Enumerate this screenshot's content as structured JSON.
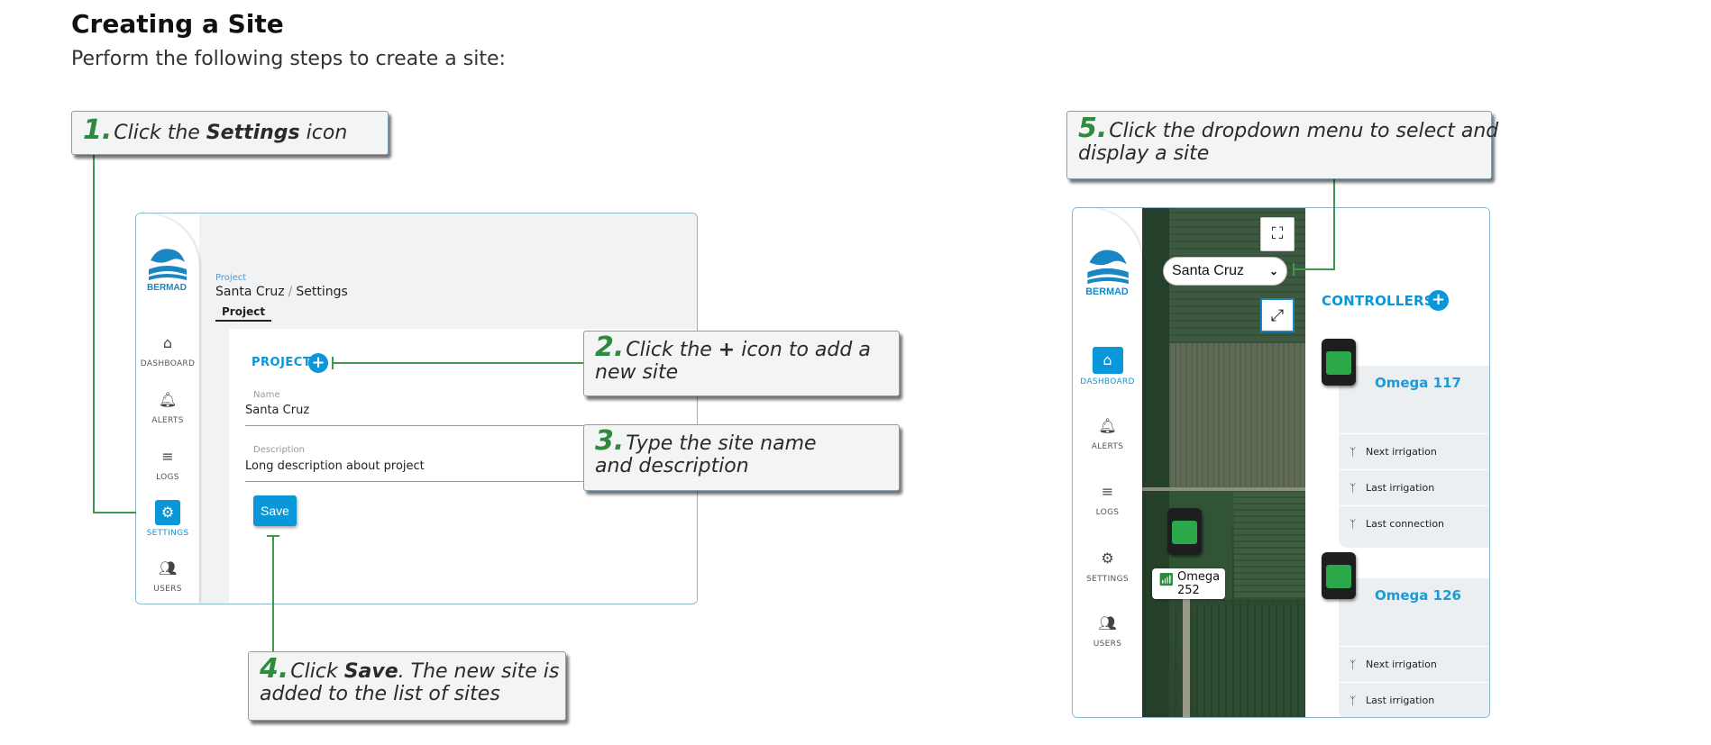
{
  "doc": {
    "title": "Creating a Site",
    "subtitle": "Perform the following steps to create a site:"
  },
  "steps": [
    {
      "num": "1.",
      "pre": "Click the ",
      "bold": "Settings",
      "post": " icon"
    },
    {
      "num": "2.",
      "line1_pre": "Click the ",
      "line1_bold": "+",
      "line1_post": " icon to add a",
      "line2": "new site"
    },
    {
      "num": "3.",
      "line1": "Type the site name",
      "line2": "and description"
    },
    {
      "num": "4.",
      "line1_pre": "Click ",
      "line1_bold": "Save",
      "line1_post": ". The new site is",
      "line2": "added to the list of sites"
    },
    {
      "num": "5.",
      "line1": "Click the dropdown menu to select and",
      "line2": "display a site"
    }
  ],
  "nav": {
    "logo_text": "BERMAD",
    "dashboard": "DASHBOARD",
    "alerts": "ALERTS",
    "logs": "LOGS",
    "settings": "SETTINGS",
    "users": "USERS"
  },
  "settings_screen": {
    "breadcrumb_label": "Project",
    "breadcrumb_project": "Santa Cruz",
    "breadcrumb_page": "Settings",
    "tab": "Project",
    "section_title": "PROJECT",
    "name_label": "Name",
    "name_value": "Santa Cruz",
    "description_label": "Description",
    "description_value": "Long description about project",
    "save_label": "Save"
  },
  "dashboard_screen": {
    "site_select_value": "Santa Cruz",
    "controllers_title": "CONTROLLERS",
    "map_device_name_1": "Omega",
    "map_device_name_2": "252",
    "controllers": [
      {
        "name": "Omega 117",
        "rows": [
          "Next irrigation",
          "Last irrigation",
          "Last connection"
        ]
      },
      {
        "name": "Omega 126",
        "rows": [
          "Next irrigation",
          "Last irrigation"
        ]
      }
    ]
  },
  "colors": {
    "accent": "#0a97d9",
    "step_number": "#2d8a3e",
    "connector": "#3d9a4c"
  }
}
